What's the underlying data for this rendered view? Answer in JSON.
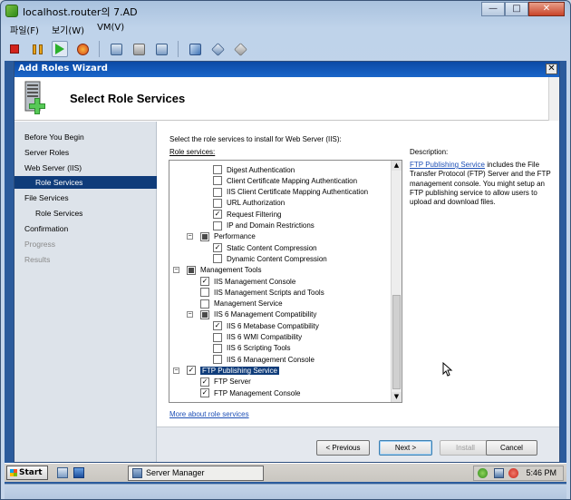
{
  "host": {
    "title": "localhost.router의 7.AD",
    "controls": {
      "minimize": "—",
      "maximize": "□",
      "close": "✕"
    },
    "menu": [
      "파일(F)",
      "보기(W)",
      "VM(V)"
    ],
    "toolbar_icons": [
      "stop-icon",
      "pause-icon",
      "play-icon",
      "reset-icon",
      "snapshot-icon",
      "revert-snapshot-icon",
      "snapshot-manager-icon",
      "send-keys-icon",
      "settings-icon",
      "tools-icon"
    ]
  },
  "wizard": {
    "title": "Add Roles Wizard",
    "close": "✕",
    "header_title": "Select Role Services",
    "nav": [
      {
        "label": "Before You Begin",
        "state": "normal",
        "level": 0
      },
      {
        "label": "Server Roles",
        "state": "normal",
        "level": 0
      },
      {
        "label": "Web Server (IIS)",
        "state": "normal",
        "level": 0
      },
      {
        "label": "Role Services",
        "state": "selected",
        "level": 1
      },
      {
        "label": "File Services",
        "state": "normal",
        "level": 0
      },
      {
        "label": "Role Services",
        "state": "normal",
        "level": 1
      },
      {
        "label": "Confirmation",
        "state": "normal",
        "level": 0
      },
      {
        "label": "Progress",
        "state": "disabled",
        "level": 0
      },
      {
        "label": "Results",
        "state": "disabled",
        "level": 0
      }
    ],
    "instruction": "Select the role services to install for Web Server (IIS):",
    "role_services_label": "Role services:",
    "tree": [
      {
        "label": "Digest Authentication",
        "level": 3,
        "checked": false,
        "expander": ""
      },
      {
        "label": "Client Certificate Mapping Authentication",
        "level": 3,
        "checked": false,
        "expander": ""
      },
      {
        "label": "IIS Client Certificate Mapping Authentication",
        "level": 3,
        "checked": false,
        "expander": ""
      },
      {
        "label": "URL Authorization",
        "level": 3,
        "checked": false,
        "expander": ""
      },
      {
        "label": "Request Filtering",
        "level": 3,
        "checked": true,
        "expander": ""
      },
      {
        "label": "IP and Domain Restrictions",
        "level": 3,
        "checked": false,
        "expander": ""
      },
      {
        "label": "Performance",
        "level": 2,
        "checked": "partial",
        "expander": "−"
      },
      {
        "label": "Static Content Compression",
        "level": 3,
        "checked": true,
        "expander": ""
      },
      {
        "label": "Dynamic Content Compression",
        "level": 3,
        "checked": false,
        "expander": ""
      },
      {
        "label": "Management Tools",
        "level": 1,
        "checked": "partial",
        "expander": "−"
      },
      {
        "label": "IIS Management Console",
        "level": 2,
        "checked": true,
        "expander": ""
      },
      {
        "label": "IIS Management Scripts and Tools",
        "level": 2,
        "checked": false,
        "expander": ""
      },
      {
        "label": "Management Service",
        "level": 2,
        "checked": false,
        "expander": ""
      },
      {
        "label": "IIS 6 Management Compatibility",
        "level": 2,
        "checked": "partial",
        "expander": "−"
      },
      {
        "label": "IIS 6 Metabase Compatibility",
        "level": 3,
        "checked": true,
        "expander": ""
      },
      {
        "label": "IIS 6 WMI Compatibility",
        "level": 3,
        "checked": false,
        "expander": ""
      },
      {
        "label": "IIS 6 Scripting Tools",
        "level": 3,
        "checked": false,
        "expander": ""
      },
      {
        "label": "IIS 6 Management Console",
        "level": 3,
        "checked": false,
        "expander": ""
      },
      {
        "label": "FTP Publishing Service",
        "level": 1,
        "checked": true,
        "expander": "−",
        "highlighted": true
      },
      {
        "label": "FTP Server",
        "level": 2,
        "checked": true,
        "expander": ""
      },
      {
        "label": "FTP Management Console",
        "level": 2,
        "checked": true,
        "expander": ""
      }
    ],
    "description_title": "Description:",
    "description_link": "FTP Publishing Service",
    "description_text": " includes the File Transfer Protocol (FTP) Server and the FTP management console. You might setup an FTP publishing service to allow users to upload and download files.",
    "more_link": "More about role services",
    "buttons": {
      "previous": "< Previous",
      "next": "Next >",
      "install": "Install",
      "cancel": "Cancel"
    }
  },
  "taskbar": {
    "start": "Start",
    "task": "Server Manager",
    "clock": "5:46 PM"
  },
  "colors": {
    "selection": "#0f3c7a",
    "link": "#1d4fb6",
    "title_bar": "#1a66c9",
    "desktop": "#2b5b9c"
  }
}
